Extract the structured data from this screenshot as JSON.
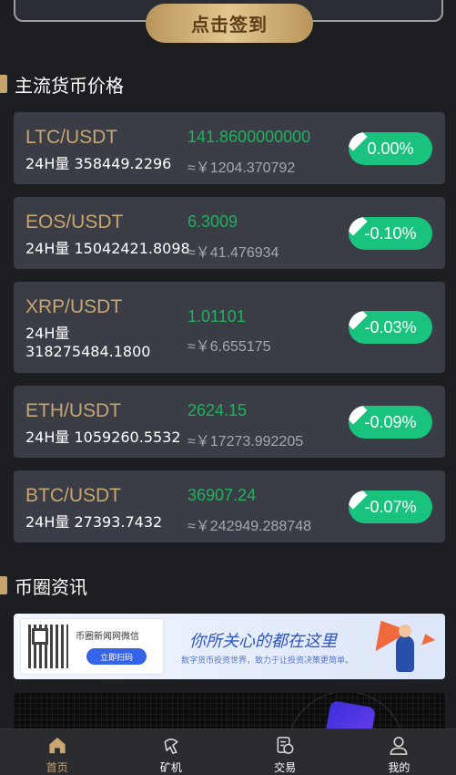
{
  "signin": {
    "label": "点击签到"
  },
  "sections": {
    "market_title": "主流货币价格",
    "news_title": "币圈资讯"
  },
  "coins": [
    {
      "pair": "LTC/USDT",
      "volume": "24H量 358449.2296",
      "price": "141.8600000000",
      "cny": "≈￥1204.370792",
      "change": "0.00%"
    },
    {
      "pair": "EOS/USDT",
      "volume": "24H量 15042421.8098",
      "price": "6.3009",
      "cny": "≈￥41.476934",
      "change": "-0.10%"
    },
    {
      "pair": "XRP/USDT",
      "volume_line1": "24H量",
      "volume_line2": "318275484.1800",
      "price": "1.01101",
      "cny": "≈￥6.655175",
      "change": "-0.03%"
    },
    {
      "pair": "ETH/USDT",
      "volume": "24H量 1059260.5532",
      "price": "2624.15",
      "cny": "≈￥17273.992205",
      "change": "-0.09%"
    },
    {
      "pair": "BTC/USDT",
      "volume": "24H量 27393.7432",
      "price": "36907.24",
      "cny": "≈￥242949.288748",
      "change": "-0.07%"
    }
  ],
  "banner": {
    "qr_title": "币圈新闻网微信",
    "qr_button": "立即扫码",
    "slogan": "你所关心的都在这里",
    "slogan_sub": "数字货币投资世界，致力于让投资决策更简单。"
  },
  "tabs": [
    {
      "label": "首页",
      "icon": "home-icon",
      "active": true
    },
    {
      "label": "矿机",
      "icon": "mining-icon",
      "active": false
    },
    {
      "label": "交易",
      "icon": "trade-icon",
      "active": false
    },
    {
      "label": "我的",
      "icon": "profile-icon",
      "active": false
    }
  ],
  "colors": {
    "background": "#1c1e22",
    "card": "#3a3d45",
    "gold": "#c9a571",
    "price_green": "#1fb25d",
    "badge_green": "#19c37d",
    "tabbar": "#2a2c30"
  }
}
